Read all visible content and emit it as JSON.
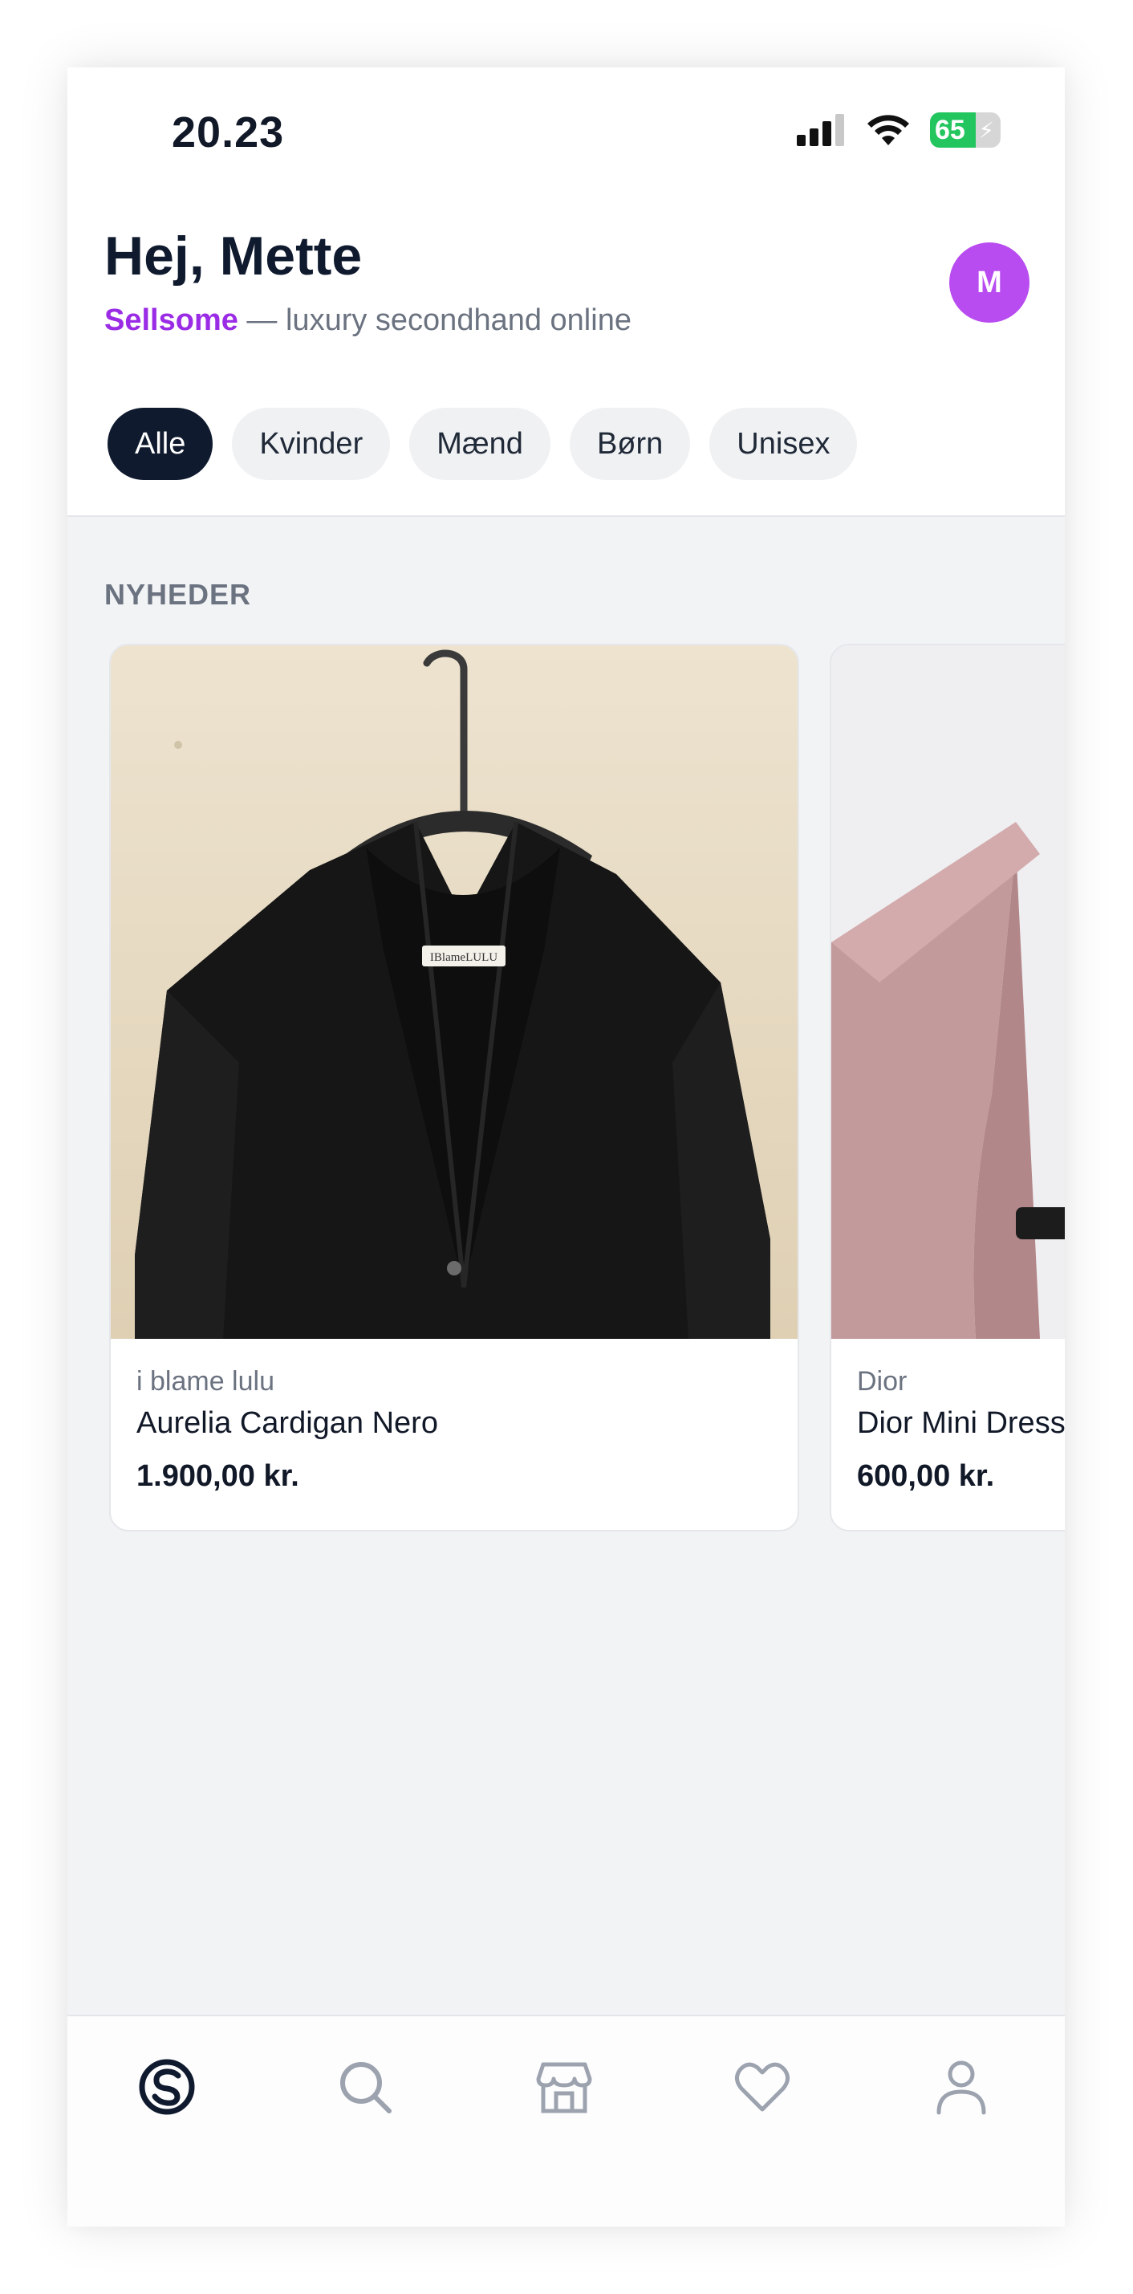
{
  "status": {
    "time": "20.23",
    "battery": "65",
    "battery_percent": 65
  },
  "header": {
    "greeting": "Hej, Mette",
    "brand": "Sellsome",
    "tagline": " — luxury secondhand online",
    "avatar_initial": "M"
  },
  "tabs": [
    {
      "label": "Alle",
      "active": true
    },
    {
      "label": "Kvinder",
      "active": false
    },
    {
      "label": "Mænd",
      "active": false
    },
    {
      "label": "Børn",
      "active": false
    },
    {
      "label": "Unisex",
      "active": false
    }
  ],
  "section": {
    "title": "NYHEDER"
  },
  "products": [
    {
      "brand": "i blame lulu",
      "name": "Aurelia Cardigan Nero",
      "price": "1.900,00 kr.",
      "label_text": "IBlameLULU"
    },
    {
      "brand": "Dior",
      "name": "Dior Mini Dress",
      "price": "600,00 kr."
    }
  ],
  "nav": [
    {
      "icon": "sellsome-logo-icon",
      "active": true
    },
    {
      "icon": "search-icon",
      "active": false
    },
    {
      "icon": "store-icon",
      "active": false
    },
    {
      "icon": "heart-icon",
      "active": false
    },
    {
      "icon": "user-icon",
      "active": false
    }
  ],
  "colors": {
    "accent": "#9b2ce6",
    "avatar": "#b84cf0",
    "dark": "#0f1a2e",
    "nav_inactive": "#9ca3af"
  }
}
